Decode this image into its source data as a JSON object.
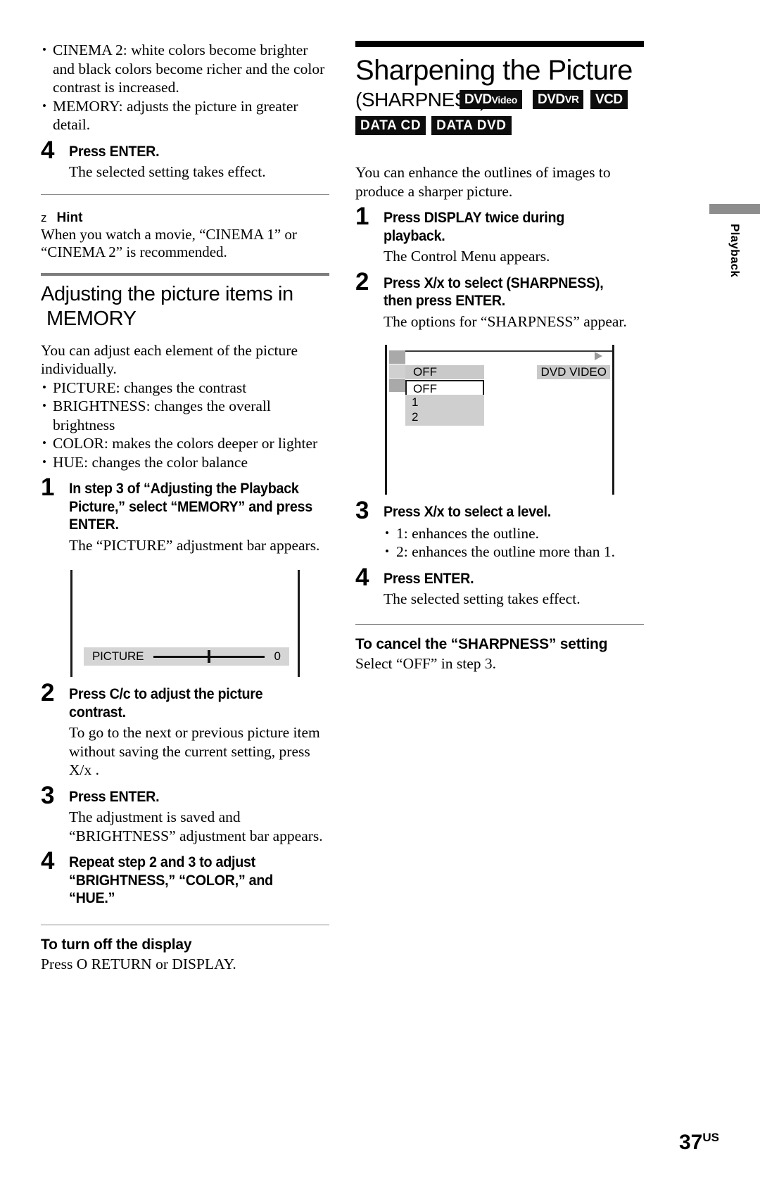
{
  "left_column": {
    "top_bullets": [
      "CINEMA 2: white colors become brighter and black colors become richer and the color contrast is increased.",
      "MEMORY: adjusts the picture in greater detail."
    ],
    "step4": {
      "num": "4",
      "head": "Press ENTER.",
      "body": "The selected setting takes effect."
    },
    "hint": {
      "icon": "z",
      "label": "Hint",
      "body": "When you watch a movie, “CINEMA 1” or “CINEMA 2” is recommended."
    },
    "section": {
      "title_line1": "Adjusting the picture items in",
      "title_line2": "MEMORY",
      "intro": "You can adjust each element of the picture individually.",
      "bullets": [
        "PICTURE: changes the contrast",
        "BRIGHTNESS: changes the overall brightness",
        "COLOR: makes the colors deeper or lighter",
        "HUE: changes the color balance"
      ]
    },
    "steps": [
      {
        "num": "1",
        "head": "In step 3 of “Adjusting the Playback Picture,” select “MEMORY” and press ENTER.",
        "body": "The “PICTURE” adjustment bar appears."
      },
      {
        "num": "2",
        "head": "Press C/c to adjust the picture contrast.",
        "body": "To go to the next or previous picture item without saving the current setting, press X/x ."
      },
      {
        "num": "3",
        "head": "Press ENTER.",
        "body": "The adjustment is saved and “BRIGHTNESS” adjustment bar appears."
      },
      {
        "num": "4",
        "head": "Repeat step 2 and 3 to adjust “BRIGHTNESS,” “COLOR,” and “HUE.”",
        "body": ""
      }
    ],
    "picture_bar": {
      "label": "PICTURE",
      "value": "0",
      "thumb_position_percent": 50
    },
    "turn_off": {
      "head": "To turn off the display",
      "body_prefix": "Press ",
      "body_icon": "O",
      "body_suffix": " RETURN or DISPLAY."
    }
  },
  "right_column": {
    "title": "Sharpening the Picture",
    "subtitle": "(SHARPNESS)",
    "badges_row1": [
      {
        "main": "DVD",
        "sub": "Video"
      },
      {
        "main": "DVD",
        "sub": "VR"
      },
      {
        "main": "VCD",
        "sub": ""
      }
    ],
    "badges_row2": [
      {
        "main": "DATA CD"
      },
      {
        "main": "DATA DVD"
      }
    ],
    "intro": "You can enhance the outlines of images to produce a sharper picture.",
    "steps": [
      {
        "num": "1",
        "head": "Press DISPLAY twice during playback.",
        "body": "The Control Menu appears."
      },
      {
        "num": "2",
        "head": "Press X/x  to select (SHARPNESS), then press ENTER.",
        "body": "The options for “SHARPNESS” appear."
      },
      {
        "num": "3",
        "head": "Press X/x  to select a level.",
        "body": "",
        "bullets": [
          "1: enhances the outline.",
          "2: enhances the outline more than 1."
        ]
      },
      {
        "num": "4",
        "head": "Press ENTER.",
        "body": "The selected setting takes effect."
      }
    ],
    "osd": {
      "status_value": "OFF",
      "selected_value": "OFF",
      "options": [
        "1",
        "2"
      ],
      "disc_label": "DVD VIDEO",
      "arrow_icon": "play-arrow-icon"
    },
    "cancel": {
      "head": "To cancel the “SHARPNESS” setting",
      "body": "Select “OFF” in step 3."
    }
  },
  "side_tab": {
    "label": "Playback"
  },
  "footer": {
    "page": "37",
    "region": "US"
  },
  "colors": {
    "rule_gray": "#7d7d7d",
    "rule_black": "#000000",
    "osd_gray": "#c9c9c9",
    "osd_icon_gray": "#a9a9a9",
    "bar_gray": "#d5d5d5",
    "tab_gray": "#8d8d8d"
  }
}
